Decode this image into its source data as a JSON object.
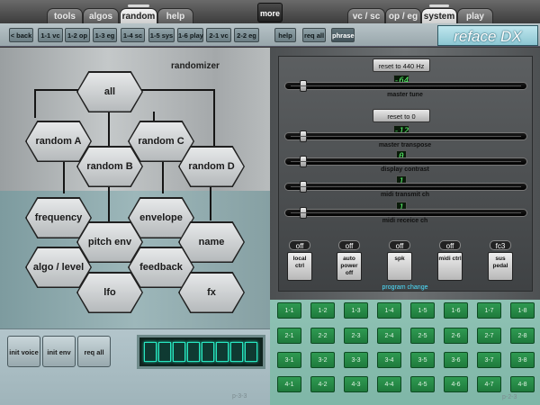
{
  "top_tabs_left": [
    {
      "label": "tools",
      "active": false
    },
    {
      "label": "algos",
      "active": false
    },
    {
      "label": "random",
      "active": true
    },
    {
      "label": "help",
      "active": false
    }
  ],
  "more_label": "more",
  "top_tabs_right": [
    {
      "label": "vc / sc",
      "active": false
    },
    {
      "label": "op / eg",
      "active": false
    },
    {
      "label": "system",
      "active": true
    },
    {
      "label": "play",
      "active": false
    }
  ],
  "subnav_left": [
    "< back",
    "1-1 vc",
    "1-2 op",
    "1-3 eg",
    "1-4 sc",
    "1-5 sys",
    "1-6 play",
    "2-1 vc",
    "2-2 eg"
  ],
  "subnav_right": [
    "help",
    "req all",
    "phrase"
  ],
  "logo": "reface DX",
  "randomizer": {
    "title": "randomizer",
    "hexes": {
      "all": "all",
      "random_a": "random A",
      "random_b": "random B",
      "random_c": "random C",
      "random_d": "random D",
      "frequency": "frequency",
      "envelope": "envelope",
      "pitch_env": "pitch env",
      "name": "name",
      "algo_level": "algo / level",
      "feedback": "feedback",
      "lfo": "lfo",
      "fx": "fx"
    }
  },
  "bottom_buttons": [
    "init voice",
    "init env",
    "req all"
  ],
  "page_left": "p-3-3",
  "page_right": "p-2-3",
  "system": {
    "reset_440": "reset to 440 Hz",
    "master_tune_value": "-64",
    "master_tune_label": "master tune",
    "reset_0": "reset to 0",
    "transpose_value": "-12",
    "transpose_label": "master transpose",
    "contrast_value": "0",
    "contrast_label": "display contrast",
    "midi_tx_value": "1",
    "midi_tx_label": "midi transmit ch",
    "midi_rx_value": "1",
    "midi_rx_label": "midi receice ch",
    "toggles": [
      {
        "value": "off",
        "label": "local ctrl"
      },
      {
        "value": "off",
        "label": "auto power off"
      },
      {
        "value": "off",
        "label": "spk"
      },
      {
        "value": "off",
        "label": "midi ctrl"
      },
      {
        "value": "fc3",
        "label": "sus pedal"
      }
    ]
  },
  "program_change": {
    "title": "program change",
    "buttons": [
      [
        "1-1",
        "1-2",
        "1-3",
        "1-4",
        "1-5",
        "1-6",
        "1-7",
        "1-8"
      ],
      [
        "2-1",
        "2-2",
        "2-3",
        "2-4",
        "2-5",
        "2-6",
        "2-7",
        "2-8"
      ],
      [
        "3-1",
        "3-2",
        "3-3",
        "3-4",
        "3-5",
        "3-6",
        "3-7",
        "3-8"
      ],
      [
        "4-1",
        "4-2",
        "4-3",
        "4-4",
        "4-5",
        "4-6",
        "4-7",
        "4-8"
      ]
    ]
  }
}
